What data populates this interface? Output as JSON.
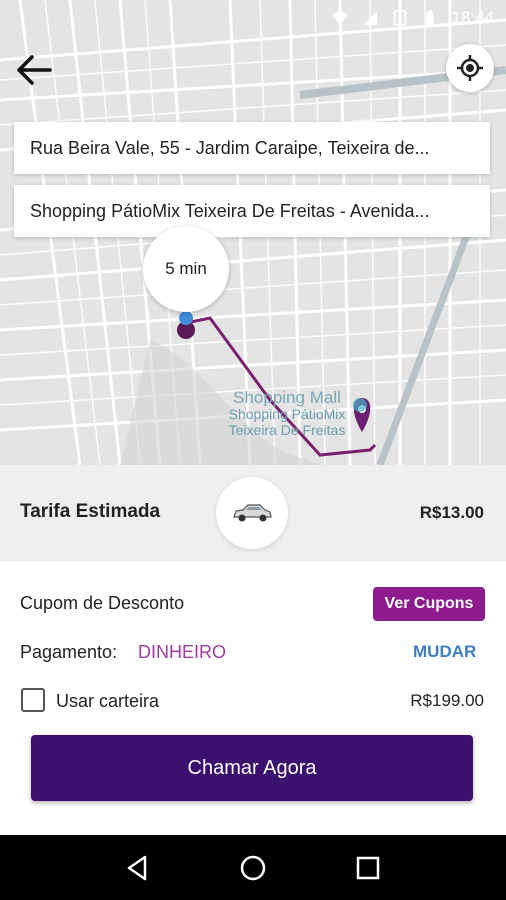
{
  "status_bar": {
    "time": "18:44"
  },
  "map": {
    "origin_address": "Rua Beira Vale, 55 - Jardim Caraipe, Teixeira de...",
    "destination_address": "Shopping PátioMix Teixeira De Freitas - Avenida...",
    "eta": "5 min",
    "poi": {
      "category": "Shopping Mall",
      "name_line1": "Shopping PátioMix",
      "name_line2": "Teixeira De Freitas"
    },
    "route_color": "#7b1f6e"
  },
  "fare": {
    "label": "Tarifa Estimada",
    "value": "R$13.00",
    "vehicle_icon": "car-icon"
  },
  "coupon": {
    "label": "Cupom de Desconto",
    "button": "Ver Cupons"
  },
  "payment": {
    "label": "Pagamento:",
    "method": "DINHEIRO",
    "change": "MUDAR"
  },
  "wallet": {
    "label": "Usar carteira",
    "value": "R$199.00",
    "checked": false
  },
  "actions": {
    "call_now": "Chamar Agora"
  },
  "colors": {
    "primary": "#3a0f6e",
    "accent": "#8e1b8e",
    "link": "#3f7cc0"
  }
}
